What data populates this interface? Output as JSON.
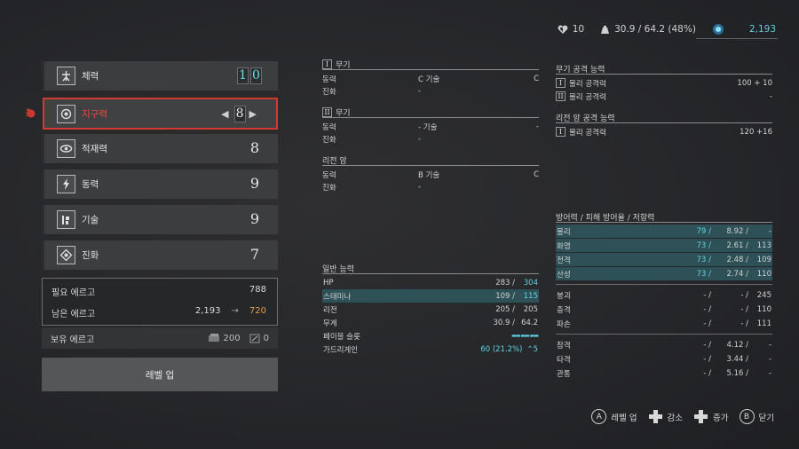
{
  "topbar": {
    "hearts": "10",
    "weight": "30.9 / 64.2 (48%)",
    "ergo": "2,193"
  },
  "stats": [
    {
      "label": "체력",
      "digits": [
        "1",
        "0"
      ],
      "icon": "vitality-icon"
    },
    {
      "label": "지구력",
      "digits": [
        "8"
      ],
      "icon": "endurance-icon"
    },
    {
      "label": "적재력",
      "digits": [
        "8"
      ],
      "icon": "capacity-icon"
    },
    {
      "label": "동력",
      "digits": [
        "9"
      ],
      "icon": "motivity-icon"
    },
    {
      "label": "기술",
      "digits": [
        "9"
      ],
      "icon": "technique-icon"
    },
    {
      "label": "진화",
      "digits": [
        "7"
      ],
      "icon": "advance-icon"
    }
  ],
  "ergo": {
    "required_label": "필요 에르고",
    "required_value": "788",
    "remaining_label": "남은 에르고",
    "remaining_from": "2,193",
    "arrow": "→",
    "remaining_to": "720",
    "keep_label": "보유 에르고",
    "keep_a": "200",
    "keep_b": "0"
  },
  "level_up_button": "레벨 업",
  "weapon1": {
    "num": "I",
    "title": "무기",
    "rows": [
      {
        "a": "동력",
        "b": "C 기술",
        "c": "C"
      },
      {
        "a": "진화",
        "b": "-",
        "c": ""
      }
    ]
  },
  "weapon2": {
    "num": "II",
    "title": "무기",
    "rows": [
      {
        "a": "동력",
        "b": "- 기술",
        "c": "-"
      },
      {
        "a": "진화",
        "b": "-",
        "c": ""
      }
    ]
  },
  "legion": {
    "title": "리전 암",
    "rows": [
      {
        "a": "동력",
        "b": "B 기술",
        "c": "C"
      },
      {
        "a": "진화",
        "b": "-",
        "c": ""
      }
    ]
  },
  "general": {
    "title": "일반 능력",
    "rows": [
      {
        "k": "HP",
        "v1": "283 /",
        "v2": "304",
        "hl": false,
        "cyan": true
      },
      {
        "k": "스태미나",
        "v1": "109 /",
        "v2": "115",
        "hl": true,
        "cyan": true
      },
      {
        "k": "리전",
        "v1": "205 /",
        "v2": "205",
        "hl": false,
        "cyan": false
      },
      {
        "k": "무게",
        "v1": "30.9 /",
        "v2": "64.2",
        "hl": false,
        "cyan": false
      },
      {
        "k": "페이블 슬롯",
        "v1": "",
        "v2": "▬▬ ▬▬ ▬▬",
        "hl": false,
        "cyan": true
      },
      {
        "k": "가드리게인",
        "v1": "60 (21.2%)",
        "v2": "⌃5",
        "hl": false,
        "cyan": true
      }
    ]
  },
  "weapon_attack": {
    "title": "무기 공격 능력",
    "rows": [
      {
        "num": "I",
        "k": "물리 공격력",
        "v": "100 + 10"
      },
      {
        "num": "II",
        "k": "물리 공격력",
        "v": "-"
      }
    ]
  },
  "legion_attack": {
    "title": "리전 암 공격 능력",
    "rows": [
      {
        "num": "I",
        "k": "물리 공격력",
        "v": "120 +16"
      }
    ]
  },
  "defense": {
    "title": "방어력 / 피해 방어율 / 저항력",
    "group1": [
      {
        "k": "물리",
        "v1": "79 /",
        "v2": "8.92 /",
        "v3": "-",
        "hl": true
      },
      {
        "k": "화염",
        "v1": "73 /",
        "v2": "2.61 /",
        "v3": "113",
        "hl": true
      },
      {
        "k": "전격",
        "v1": "73 /",
        "v2": "2.48 /",
        "v3": "109",
        "hl": true
      },
      {
        "k": "산성",
        "v1": "73 /",
        "v2": "2.74 /",
        "v3": "110",
        "hl": true
      }
    ],
    "group2": [
      {
        "k": "붕괴",
        "v1": "- /",
        "v2": "- /",
        "v3": "245"
      },
      {
        "k": "충격",
        "v1": "- /",
        "v2": "- /",
        "v3": "110"
      },
      {
        "k": "파손",
        "v1": "- /",
        "v2": "- /",
        "v3": "111"
      }
    ],
    "group3": [
      {
        "k": "참격",
        "v1": "- /",
        "v2": "4.12 /",
        "v3": "-"
      },
      {
        "k": "타격",
        "v1": "- /",
        "v2": "3.44 /",
        "v3": "-"
      },
      {
        "k": "관통",
        "v1": "- /",
        "v2": "5.16 /",
        "v3": "-"
      }
    ]
  },
  "hints": {
    "a_key": "A",
    "a_label": "레벨 업",
    "dec_label": "감소",
    "inc_label": "증가",
    "b_key": "B",
    "b_label": "닫기"
  }
}
